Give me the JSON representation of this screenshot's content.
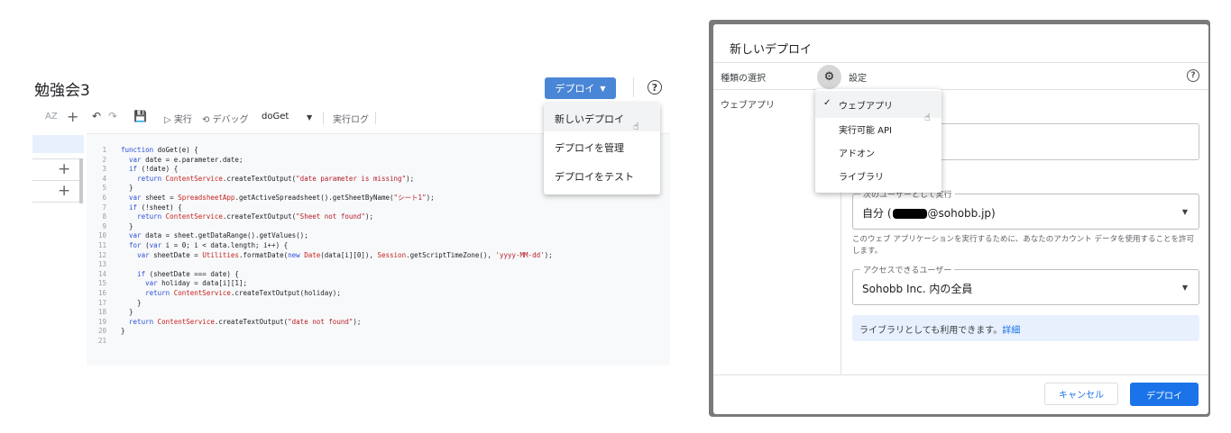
{
  "editor": {
    "project_title": "勉強会3",
    "deploy_button": "デプロイ",
    "help_icon": "?",
    "toolbar": {
      "az": "AZ",
      "add": "+",
      "undo": "↶",
      "redo": "↷",
      "save": "💾",
      "run": "▷ 実行",
      "debug": "⟲ デバッグ",
      "function": "doGet",
      "log": "実行ログ"
    },
    "sidebar_add_1": "+",
    "sidebar_add_2": "+",
    "deploy_menu": [
      "新しいデプロイ",
      "デプロイを管理",
      "デプロイをテスト"
    ],
    "code_lines": [
      {
        "n": "1",
        "c": "function doGet(e) {"
      },
      {
        "n": "2",
        "c": "  var date = e.parameter.date;"
      },
      {
        "n": "3",
        "c": "  if (!date) {"
      },
      {
        "n": "4",
        "c": "    return ContentService.createTextOutput(\"date parameter is missing\");"
      },
      {
        "n": "5",
        "c": "  }"
      },
      {
        "n": "6",
        "c": "  var sheet = SpreadsheetApp.getActiveSpreadsheet().getSheetByName(\"シート1\");"
      },
      {
        "n": "7",
        "c": "  if (!sheet) {"
      },
      {
        "n": "8",
        "c": "    return ContentService.createTextOutput(\"Sheet not found\");"
      },
      {
        "n": "9",
        "c": "  }"
      },
      {
        "n": "10",
        "c": "  var data = sheet.getDataRange().getValues();"
      },
      {
        "n": "11",
        "c": "  for (var i = 0; i < data.length; i++) {"
      },
      {
        "n": "12",
        "c": "    var sheetDate = Utilities.formatDate(new Date(data[i][0]), Session.getScriptTimeZone(), 'yyyy-MM-dd');"
      },
      {
        "n": "13",
        "c": ""
      },
      {
        "n": "14",
        "c": "    if (sheetDate === date) {"
      },
      {
        "n": "15",
        "c": "      var holiday = data[i][1];"
      },
      {
        "n": "16",
        "c": "      return ContentService.createTextOutput(holiday);"
      },
      {
        "n": "17",
        "c": "    }"
      },
      {
        "n": "18",
        "c": "  }"
      },
      {
        "n": "19",
        "c": "  return ContentService.createTextOutput(\"date not found\");"
      },
      {
        "n": "20",
        "c": "}"
      },
      {
        "n": "21",
        "c": ""
      }
    ]
  },
  "dialog": {
    "title": "新しいデプロイ",
    "type_label": "種類の選択",
    "settings_label": "設定",
    "webapp_label": "ウェブアプリ",
    "help_icon": "?",
    "type_menu": {
      "check": "✓",
      "items": [
        "ウェブアプリ",
        "実行可能 API",
        "アドオン",
        "ライブラリ"
      ]
    },
    "execute_as": {
      "legend": "次のユーザーとして実行",
      "value_prefix": "自分 (",
      "value_suffix": "@sohobb.jp)"
    },
    "help_text": "このウェブ アプリケーションを実行するために、あなたのアカウント データを使用することを許可します。",
    "access": {
      "legend": "アクセスできるユーザー",
      "value": "Sohobb Inc. 内の全員"
    },
    "info": {
      "text": "ライブラリとしても利用できます。",
      "link": "詳細"
    },
    "cancel_button": "キャンセル",
    "deploy_button": "デプロイ"
  }
}
